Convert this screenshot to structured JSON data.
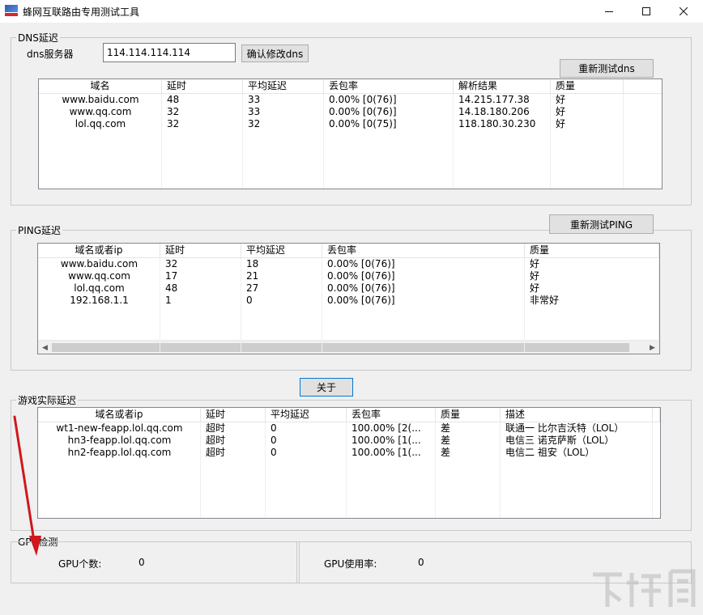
{
  "window": {
    "title": "蜂网互联路由专用测试工具",
    "min_icon": "minimize-icon",
    "max_icon": "maximize-icon",
    "close_icon": "close-icon"
  },
  "dns": {
    "legend": "DNS延迟",
    "server_label": "dns服务器",
    "server_value": "114.114.114.114",
    "confirm_button": "确认修改dns",
    "retest_button": "重新测试dns",
    "columns": [
      "域名",
      "延时",
      "平均延迟",
      "丢包率",
      "解析结果",
      "质量"
    ],
    "rows": [
      [
        "www.baidu.com",
        "48",
        "33",
        "0.00%    [0(76)]",
        "14.215.177.38",
        "好"
      ],
      [
        "www.qq.com",
        "32",
        "33",
        "0.00%    [0(76)]",
        "14.18.180.206",
        "好"
      ],
      [
        "lol.qq.com",
        "32",
        "32",
        "0.00%    [0(75)]",
        "118.180.30.230",
        "好"
      ]
    ]
  },
  "ping": {
    "legend": "PING延迟",
    "retest_button": "重新测试PING",
    "columns": [
      "域名或者ip",
      "延时",
      "平均延迟",
      "丢包率",
      "质量"
    ],
    "rows": [
      [
        "www.baidu.com",
        "32",
        "18",
        "0.00%    [0(76)]",
        "好"
      ],
      [
        "www.qq.com",
        "17",
        "21",
        "0.00%    [0(76)]",
        "好"
      ],
      [
        "lol.qq.com",
        "48",
        "27",
        "0.00%    [0(76)]",
        "好"
      ],
      [
        "192.168.1.1",
        "1",
        "0",
        "0.00%    [0(76)]",
        "非常好"
      ]
    ]
  },
  "about_button": "关于",
  "game": {
    "legend": "游戏实际延迟",
    "columns": [
      "域名或者ip",
      "延时",
      "平均延迟",
      "丢包率",
      "质量",
      "描述"
    ],
    "rows": [
      [
        "wt1-new-feapp.lol.qq.com",
        "超时",
        "0",
        "100.00%   [2(...",
        "差",
        "联通一 比尔吉沃特（LOL）"
      ],
      [
        "hn3-feapp.lol.qq.com",
        "超时",
        "0",
        "100.00%   [1(...",
        "差",
        "电信三 诺克萨斯（LOL）"
      ],
      [
        "hn2-feapp.lol.qq.com",
        "超时",
        "0",
        "100.00%   [1(...",
        "差",
        "电信二 祖安（LOL）"
      ]
    ]
  },
  "gpu": {
    "legend": "GPU检测",
    "count_label": "GPU个数:",
    "count_value": "0",
    "usage_label": "GPU使用率:",
    "usage_value": "0"
  },
  "colors": {
    "arrow": "#d0171c",
    "focus_border": "#0078d7"
  }
}
